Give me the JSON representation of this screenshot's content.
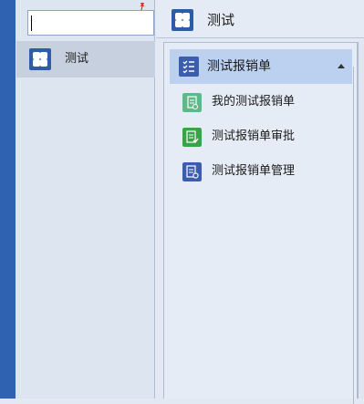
{
  "search": {
    "value": "",
    "placeholder": ""
  },
  "sidebar": {
    "items": [
      {
        "label": "测试",
        "icon": "tile-grid-icon",
        "selected": true
      }
    ]
  },
  "header": {
    "title": "测试",
    "icon": "tile-grid-icon"
  },
  "menu_group": {
    "label": "测试报销单",
    "icon": "checklist-icon",
    "expanded": true,
    "items": [
      {
        "label": "我的测试报销单",
        "icon": "document-icon",
        "color": "#5fb889"
      },
      {
        "label": "测试报销单审批",
        "icon": "approval-document-icon",
        "color": "#3aa24a"
      },
      {
        "label": "测试报销单管理",
        "icon": "manage-document-icon",
        "color": "#3c5dae"
      }
    ]
  },
  "colors": {
    "accent": "#2f62b0",
    "selected_row": "#c7d0de",
    "group_header": "#bcd1ef",
    "pin": "#e0322a"
  }
}
